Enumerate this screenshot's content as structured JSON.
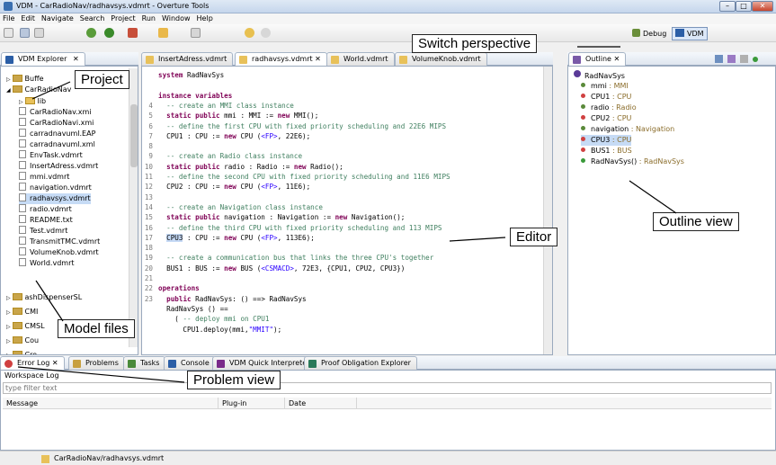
{
  "window": {
    "title": "VDM - CarRadioNav/radhavsys.vdmrt - Overture Tools",
    "buttons": [
      "–",
      "□",
      "✕"
    ]
  },
  "menu": [
    "File",
    "Edit",
    "Navigate",
    "Search",
    "Project",
    "Run",
    "Window",
    "Help"
  ],
  "perspectives": {
    "debug": "Debug",
    "vdm": "VDM"
  },
  "explorer": {
    "tab": "VDM Explorer",
    "items": [
      {
        "label": "Buffe",
        "type": "project"
      },
      {
        "label": "CarRadioNav",
        "type": "project"
      },
      {
        "label": "lib",
        "type": "folder"
      },
      {
        "label": "CarRadioNav.xmi",
        "type": "file"
      },
      {
        "label": "CarRadioNavi.xmi",
        "type": "file"
      },
      {
        "label": "carradnavuml.EAP",
        "type": "file"
      },
      {
        "label": "carradnavuml.xml",
        "type": "file"
      },
      {
        "label": "EnvTask.vdmrt",
        "type": "file"
      },
      {
        "label": "InsertAdress.vdmrt",
        "type": "file"
      },
      {
        "label": "mmi.vdmrt",
        "type": "file"
      },
      {
        "label": "navigation.vdmrt",
        "type": "file"
      },
      {
        "label": "radhavsys.vdmrt",
        "type": "file"
      },
      {
        "label": "radio.vdmrt",
        "type": "file"
      },
      {
        "label": "README.txt",
        "type": "file"
      },
      {
        "label": "Test.vdmrt",
        "type": "file"
      },
      {
        "label": "TransmitTMC.vdmrt",
        "type": "file"
      },
      {
        "label": "VolumeKnob.vdmrt",
        "type": "file"
      },
      {
        "label": "World.vdmrt",
        "type": "file"
      },
      {
        "label": "ashDispenserSL",
        "type": "project"
      },
      {
        "label": "CMI",
        "type": "project"
      },
      {
        "label": "CMSL",
        "type": "project"
      },
      {
        "label": "Cou",
        "type": "project"
      },
      {
        "label": "Cro",
        "type": "project"
      }
    ]
  },
  "editor": {
    "tabs": [
      "InsertAdress.vdmrt",
      "radhavsys.vdmrt",
      "World.vdmrt",
      "VolumeKnob.vdmrt"
    ],
    "lines": [
      {
        "n": "",
        "html": "<span class='kw'>system</span> RadNavSys"
      },
      {
        "n": "",
        "html": ""
      },
      {
        "n": "",
        "html": "<span class='kw'>instance variables</span>"
      },
      {
        "n": "4",
        "html": "  <span class='cm'>-- create an MMI class instance</span>"
      },
      {
        "n": "5",
        "html": "  <span class='kw'>static public</span> mmi : MMI := <span class='kw'>new</span> MMI();"
      },
      {
        "n": "6",
        "html": "  <span class='cm'>-- define the first CPU with fixed priority scheduling and 22E6 MIPS</span>"
      },
      {
        "n": "7",
        "html": "  CPU1 : CPU := <span class='kw'>new</span> CPU (<span class='st'>&lt;FP&gt;</span>, 22E6);"
      },
      {
        "n": "8",
        "html": ""
      },
      {
        "n": "9",
        "html": "  <span class='cm'>-- create an Radio class instance</span>"
      },
      {
        "n": "10",
        "html": "  <span class='kw'>static public</span> radio : Radio := <span class='kw'>new</span> Radio();"
      },
      {
        "n": "11",
        "html": "  <span class='cm'>-- define the second CPU with fixed priority scheduling and 11E6 MIPS</span>"
      },
      {
        "n": "12",
        "html": "  CPU2 : CPU := <span class='kw'>new</span> CPU (<span class='st'>&lt;FP&gt;</span>, 11E6);"
      },
      {
        "n": "13",
        "html": ""
      },
      {
        "n": "14",
        "html": "  <span class='cm'>-- create an Navigation class instance</span>"
      },
      {
        "n": "15",
        "html": "  <span class='kw'>static public</span> navigation : Navigation := <span class='kw'>new</span> Navigation();"
      },
      {
        "n": "16",
        "html": "  <span class='cm'>-- define the third CPU with fixed priority scheduling and 113 MIPS</span>"
      },
      {
        "n": "17",
        "html": "  <span class='hl'>CPU3</span> : CPU := <span class='kw'>new</span> CPU (<span class='st'>&lt;FP&gt;</span>, 113E6);"
      },
      {
        "n": "18",
        "html": ""
      },
      {
        "n": "19",
        "html": "  <span class='cm'>-- create a communication bus that links the three CPU's together</span>"
      },
      {
        "n": "20",
        "html": "  BUS1 : BUS := <span class='kw'>new</span> BUS (<span class='st'>&lt;CSMACD&gt;</span>, 72E3, {CPU1, CPU2, CPU3})"
      },
      {
        "n": "21",
        "html": ""
      },
      {
        "n": "22",
        "html": "<span class='kw'>operations</span>"
      },
      {
        "n": "23",
        "html": "  <span class='kw'>public</span> RadNavSys: () ==&gt; RadNavSys"
      },
      {
        "n": "",
        "html": "  RadNavSys () =="
      },
      {
        "n": "",
        "html": "    ( <span class='cm'>-- deploy mmi on CPU1</span>"
      },
      {
        "n": "",
        "html": "      CPU1.deploy(mmi,<span class='st'>\"MMIT\"</span>);"
      }
    ]
  },
  "outline": {
    "tab": "Outline",
    "root": "RadNavSys",
    "items": [
      {
        "name": "mmi",
        "type": ": MMI",
        "color": "#5a8a3a"
      },
      {
        "name": "CPU1",
        "type": ": CPU",
        "color": "#d04040"
      },
      {
        "name": "radio",
        "type": ": Radio",
        "color": "#5a8a3a"
      },
      {
        "name": "CPU2",
        "type": ": CPU",
        "color": "#d04040"
      },
      {
        "name": "navigation",
        "type": ": Navigation",
        "color": "#5a8a3a"
      },
      {
        "name": "CPU3",
        "type": ": CPU",
        "color": "#d04040"
      },
      {
        "name": "BUS1",
        "type": ": BUS",
        "color": "#d04040"
      },
      {
        "name": "RadNavSys()",
        "type": ": RadNavSys",
        "color": "#3a9a3a"
      }
    ]
  },
  "bottom": {
    "tabs": [
      "Error Log",
      "Problems",
      "Tasks",
      "Console",
      "VDM Quick Interpreter",
      "Proof Obligation Explorer"
    ],
    "workspace_label": "Workspace Log",
    "filter_placeholder": "type filter text",
    "columns": [
      "Message",
      "Plug-in",
      "Date"
    ]
  },
  "status": {
    "path": "CarRadioNav/radhavsys.vdmrt"
  },
  "callouts": {
    "project": "Project",
    "switch": "Switch perspective",
    "outline": "Outline view",
    "editor": "Editor",
    "model": "Model files",
    "problem": "Problem view"
  }
}
